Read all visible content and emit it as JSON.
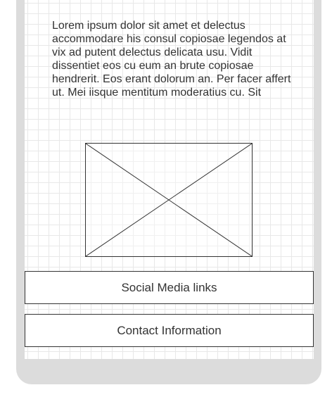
{
  "content": {
    "paragraph": "Lorem ipsum dolor sit amet et delectus accommodare his consul copiosae legendos at vix ad putent delectus delicata usu. Vidit dissentiet eos cu eum an brute copiosae hendrerit. Eos erant dolorum an. Per facer affert ut. Mei iisque mentitum moderatius cu. Sit",
    "image": {
      "icon": "image-placeholder-icon"
    }
  },
  "footer": {
    "social_label": "Social Media links",
    "contact_label": "Contact Information"
  },
  "colors": {
    "frame": "#dcdcdc",
    "grid": "#e8e8e8",
    "stroke": "#333333",
    "text": "#333333"
  }
}
